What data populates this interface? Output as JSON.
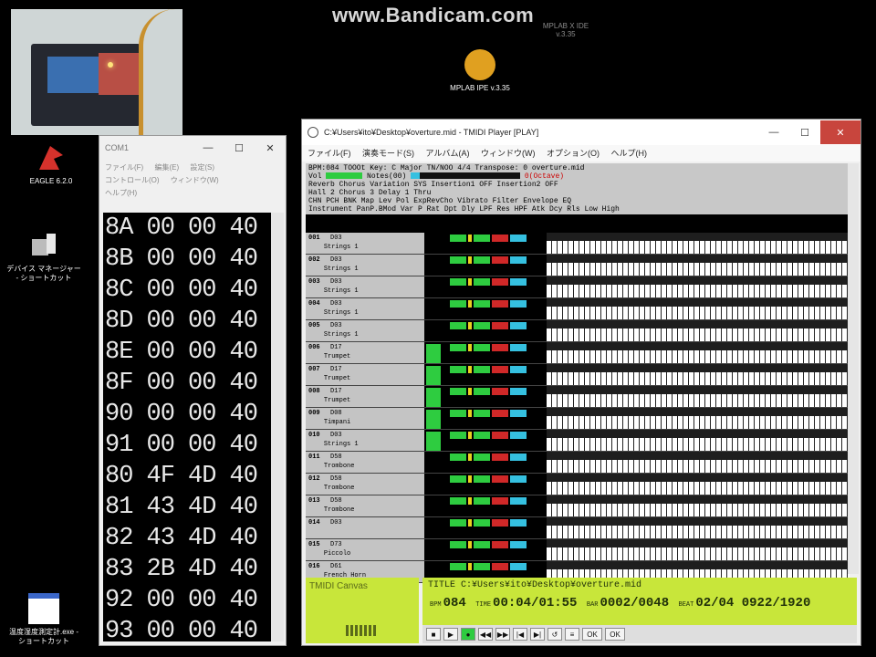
{
  "watermark": "www.Bandicam.com",
  "desktop": {
    "icons": [
      {
        "label": "MPLAB IPE v.3.35"
      },
      {
        "label": "EAGLE 6.2.0"
      },
      {
        "label": "デバイス マネージャー - ショートカット"
      },
      {
        "label": "温度湿度測定計.exe - ショートカット"
      }
    ],
    "faint_labels": [
      "MPLAB X IDE v.3.35"
    ]
  },
  "hexwin": {
    "title": "COM1",
    "menu": [
      "ファイル(F)",
      "編集(E)",
      "設定(S)",
      "コントロール(O)",
      "ウィンドウ(W)",
      "ヘルプ(H)"
    ],
    "rows": [
      [
        "8A",
        "00",
        "00",
        "40"
      ],
      [
        "8B",
        "00",
        "00",
        "40"
      ],
      [
        "8C",
        "00",
        "00",
        "40"
      ],
      [
        "8D",
        "00",
        "00",
        "40"
      ],
      [
        "8E",
        "00",
        "00",
        "40"
      ],
      [
        "8F",
        "00",
        "00",
        "40"
      ],
      [
        "90",
        "00",
        "00",
        "40"
      ],
      [
        "91",
        "00",
        "00",
        "40"
      ],
      [
        "80",
        "4F",
        "4D",
        "40"
      ],
      [
        "81",
        "43",
        "4D",
        "40"
      ],
      [
        "82",
        "43",
        "4D",
        "40"
      ],
      [
        "83",
        "2B",
        "4D",
        "40"
      ],
      [
        "92",
        "00",
        "00",
        "40"
      ],
      [
        "93",
        "00",
        "00",
        "40"
      ]
    ]
  },
  "tmidi": {
    "title": "C:¥Users¥ito¥Desktop¥overture.mid - TMIDI Player [PLAY]",
    "menu": [
      "ファイル(F)",
      "演奏モード(S)",
      "アルバム(A)",
      "ウィンドウ(W)",
      "オプション(O)",
      "ヘルプ(H)"
    ],
    "header": {
      "line1": "BPM:084  TOOOt Key: C Major TN/NOO  4/4  Transpose: 0  overture.mid",
      "line2_prefix": "Vol",
      "line2_mid": "Notes(00)",
      "line2_octave": "0(Octave)",
      "line3": "Reverb       Chorus        Variation   SYS  Insertion1 OFF  Insertion2 OFF",
      "line4": "Hall 2       Chorus 3      Delay 1      Thru",
      "line5": "CHN PCH BNK Map       Lev Pol ExpRevCho Vibrato  Filter  Envelope EQ",
      "line6": "   Instrument                 PanP.BMod Var P  Rat Dpt Dly LPF Res HPF Atk Dcy Rls Low High"
    },
    "tracks": [
      {
        "num": "001",
        "bank": "D03",
        "inst": "Strings 1",
        "level": 0
      },
      {
        "num": "002",
        "bank": "D03",
        "inst": "Strings 1",
        "level": 0
      },
      {
        "num": "003",
        "bank": "D03",
        "inst": "Strings 1",
        "level": 0
      },
      {
        "num": "004",
        "bank": "D03",
        "inst": "Strings 1",
        "level": 0
      },
      {
        "num": "005",
        "bank": "D03",
        "inst": "Strings 1",
        "level": 0
      },
      {
        "num": "006",
        "bank": "D17",
        "inst": "Trumpet",
        "level": 0.9
      },
      {
        "num": "007",
        "bank": "D17",
        "inst": "Trumpet",
        "level": 0.9
      },
      {
        "num": "008",
        "bank": "D17",
        "inst": "Trumpet",
        "level": 0.9
      },
      {
        "num": "009",
        "bank": "D08",
        "inst": "Timpani",
        "level": 0.9
      },
      {
        "num": "010",
        "bank": "D03",
        "inst": "Strings 1",
        "level": 0.9
      },
      {
        "num": "011",
        "bank": "D58",
        "inst": "Trombone",
        "level": 0
      },
      {
        "num": "012",
        "bank": "D58",
        "inst": "Trombone",
        "level": 0
      },
      {
        "num": "013",
        "bank": "D58",
        "inst": "Trombone",
        "level": 0
      },
      {
        "num": "014",
        "bank": "D03",
        "inst": "",
        "level": 0
      },
      {
        "num": "015",
        "bank": "D73",
        "inst": "Piccolo",
        "level": 0
      },
      {
        "num": "016",
        "bank": "D61",
        "inst": "French Horn",
        "level": 0
      }
    ],
    "canvas_title": "TMIDI Canvas",
    "status": {
      "title": "TITLE C:¥Users¥ito¥Desktop¥overture.mid",
      "bpm_label": "BPM",
      "bpm": "084",
      "time_label": "TIME",
      "time": "00:04/01:55",
      "bar_label": "BAR",
      "bar": "0002/0048",
      "beat_label": "BEAT",
      "beat": "02/04",
      "tick": "0922/1920"
    },
    "controls": [
      "■",
      "▶",
      "●",
      "◀◀",
      "▶▶",
      "|◀",
      "▶|",
      "↺",
      "≡",
      "OK",
      "OK"
    ]
  },
  "colors": {
    "lcd": "#c8e63a",
    "meter": "#2ecc40",
    "close": "#c8453d"
  }
}
